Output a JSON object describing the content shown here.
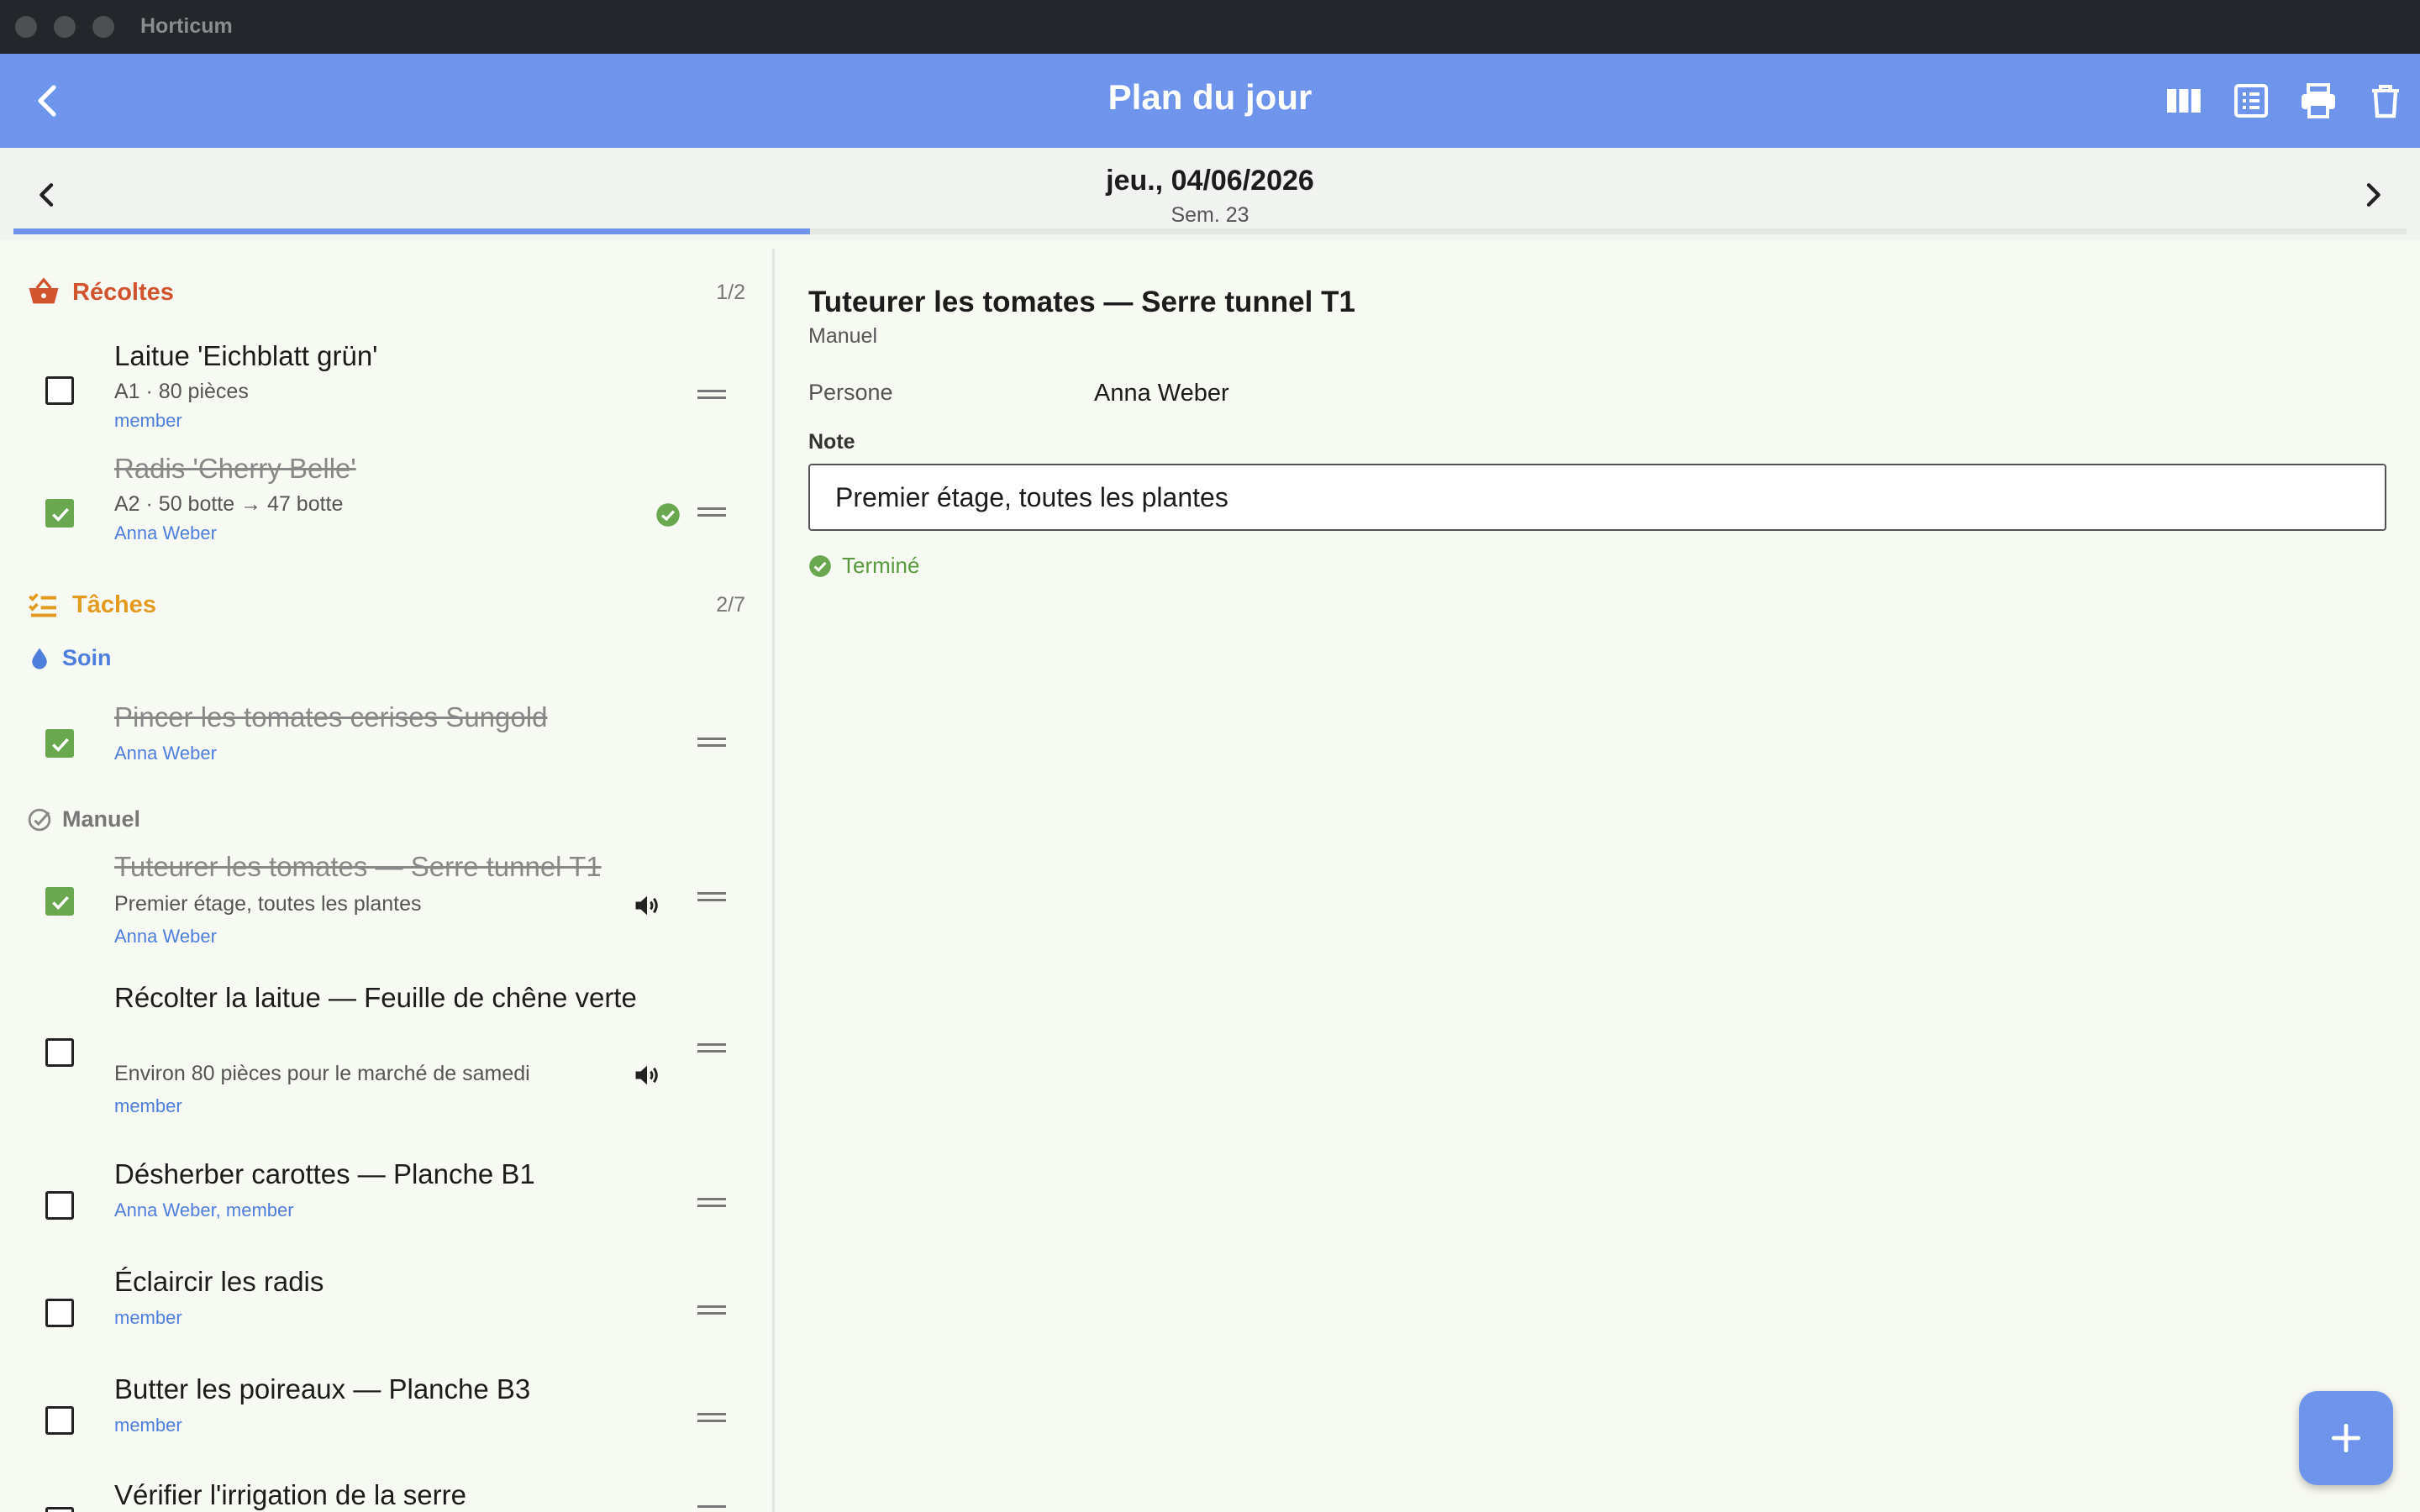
{
  "window": {
    "title": "Horticum"
  },
  "appbar": {
    "title": "Plan du jour"
  },
  "datebar": {
    "date": "jeu., 04/06/2026",
    "week": "Sem. 23"
  },
  "progress": {
    "fraction": 0.333
  },
  "harvests": {
    "title": "Récoltes",
    "count": "1/2",
    "items": [
      {
        "title": "Laitue 'Eichblatt grün'",
        "sub": "A1 · 80 pièces",
        "person": "member",
        "done": false
      },
      {
        "title": "Radis 'Cherry Belle'",
        "sub": "A2 · 50 botte → 47 botte",
        "person": "Anna Weber",
        "done": true
      }
    ]
  },
  "tasks": {
    "title": "Tâches",
    "count": "2/7",
    "groups": [
      {
        "title": "Soin",
        "items": [
          {
            "title": "Pincer les tomates cerises Sungold",
            "person": "Anna Weber",
            "done": true
          }
        ]
      },
      {
        "title": "Manuel",
        "items": [
          {
            "title": "Tuteurer les tomates — Serre tunnel T1",
            "sub": "Premier étage, toutes les plantes",
            "person": "Anna Weber",
            "done": true
          },
          {
            "title": "Récolter la laitue — Feuille de chêne verte",
            "sub": "Environ 80 pièces pour le marché de samedi",
            "person": "member",
            "done": false
          },
          {
            "title": "Désherber carottes — Planche B1",
            "person": "Anna Weber, member",
            "done": false
          },
          {
            "title": "Éclaircir les radis",
            "person": "member",
            "done": false
          },
          {
            "title": "Butter les poireaux — Planche B3",
            "person": "member",
            "done": false
          },
          {
            "title": "Vérifier l'irrigation de la serre",
            "done": false
          }
        ]
      }
    ]
  },
  "detail": {
    "title": "Tuteurer les tomates — Serre tunnel T1",
    "type": "Manuel",
    "person_label": "Persone",
    "person_value": "Anna Weber",
    "note_label": "Note",
    "note_value": "Premier étage, toutes les plantes",
    "status": "Terminé"
  },
  "colors": {
    "accent": "#6e94ec",
    "harvest": "#d2542f",
    "tasks": "#e29b1e",
    "done": "#6aa84f",
    "person": "#4f7fdc"
  },
  "icons": [
    "back-icon",
    "columns-icon",
    "list-icon",
    "print-icon",
    "trash-icon",
    "chevron-left-icon",
    "chevron-right-icon",
    "basket-icon",
    "checklist-icon",
    "drop-icon",
    "check-circle-icon",
    "speaker-icon",
    "drag-handle-icon",
    "plus-icon"
  ]
}
